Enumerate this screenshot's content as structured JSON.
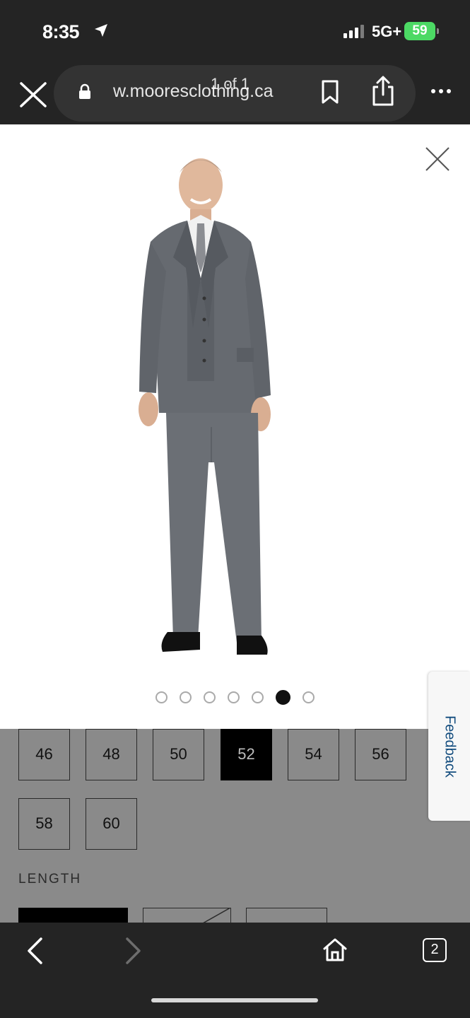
{
  "status": {
    "time": "8:35",
    "network": "5G+",
    "battery": "59"
  },
  "browser": {
    "url": "w.mooresclоthing.ca",
    "page_count": "1 of 1",
    "tab_count": "2"
  },
  "gallery": {
    "image_alt": "Man in grey three-piece suit",
    "dot_count": 7,
    "active_dot": 5
  },
  "product": {
    "sizes": [
      "46",
      "48",
      "50",
      "52",
      "54",
      "56",
      "58",
      "60"
    ],
    "selected_size": "52",
    "length_label": "LENGTH"
  },
  "feedback_label": "Feedback",
  "colors": {
    "chrome": "#242424",
    "dim": "#8a8a8a",
    "suit": "#666a70",
    "feedback_text": "#114b7d",
    "battery": "#4cd964"
  }
}
